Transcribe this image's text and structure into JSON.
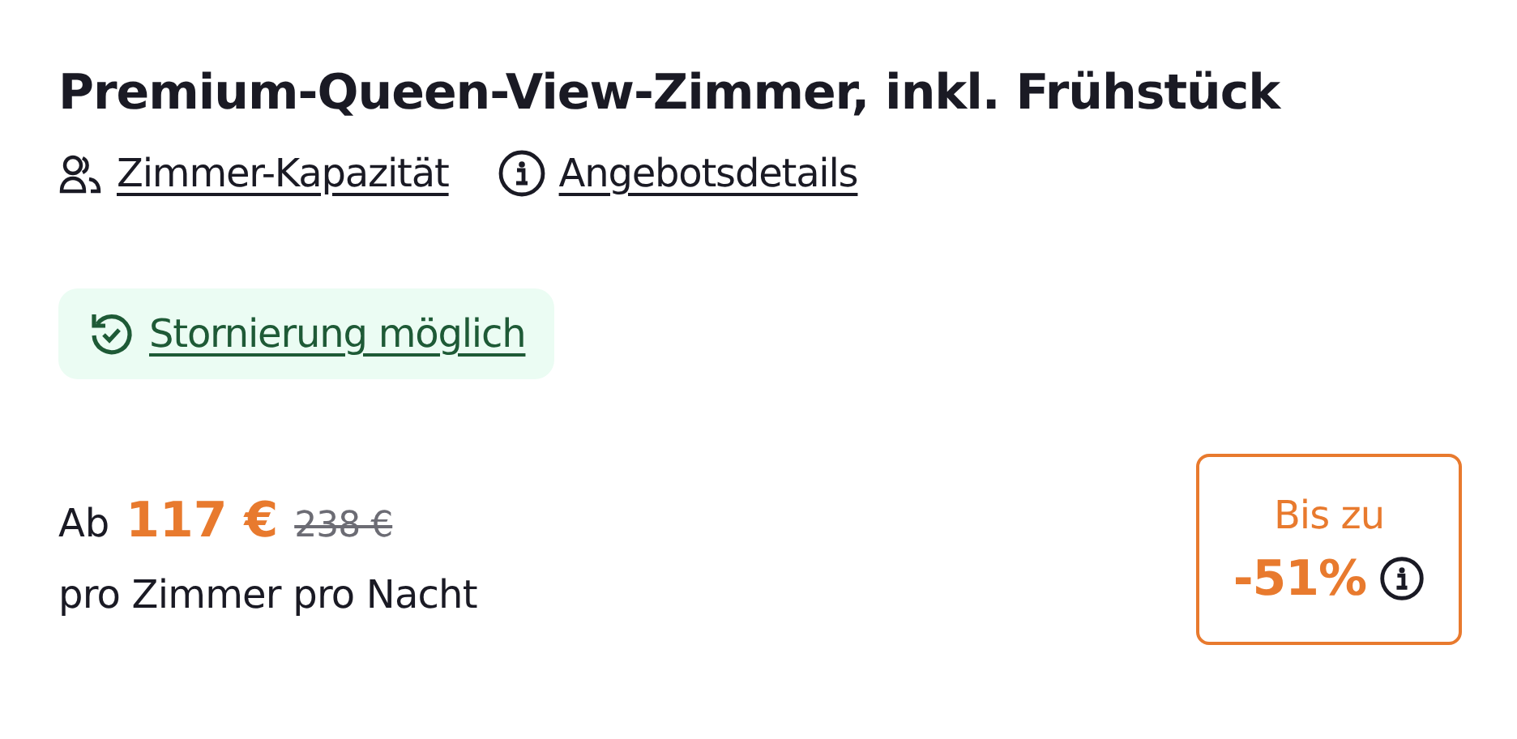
{
  "title": "Premium-Queen-View-Zimmer, inkl. Frühstück",
  "links": [
    {
      "kind": "capacity",
      "label": "Zimmer-Kapazität"
    },
    {
      "kind": "info",
      "label": "Angebotsdetails"
    }
  ],
  "cancellation": {
    "label": "Stornierung möglich"
  },
  "price": {
    "prefix": "Ab",
    "current": "117 €",
    "original": "238 €",
    "unit": "pro Zimmer pro Nacht"
  },
  "discount": {
    "label": "Bis zu",
    "value": "-51%"
  }
}
